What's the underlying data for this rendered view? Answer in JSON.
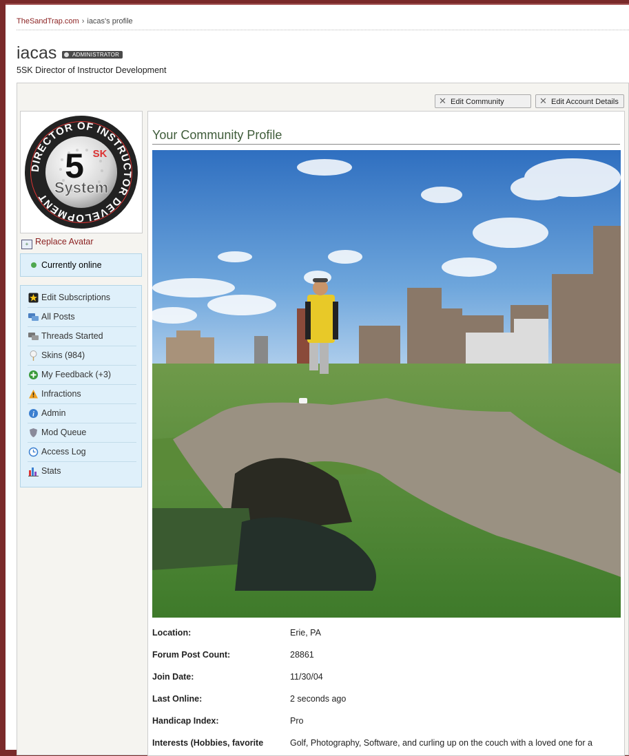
{
  "breadcrumb": {
    "home": "TheSandTrap.com",
    "separator": "›",
    "current": "iacas's profile"
  },
  "profile": {
    "username": "iacas",
    "badge": "ADMINISTRATOR",
    "user_title": "5SK Director of Instructor Development"
  },
  "toolbar": {
    "edit_community_profile": "Edit Community Profile",
    "edit_account_details": "Edit Account Details"
  },
  "avatar": {
    "ring_text": "DIRECTOR OF INSTRUCTOR DEVELOPMENT",
    "logo_number": "5",
    "logo_superscript": "SK",
    "logo_word": "System"
  },
  "sidebar": {
    "replace_avatar": "Replace Avatar",
    "online_status": "Currently online",
    "items": [
      {
        "label": "Edit Subscriptions",
        "icon": "star-icon"
      },
      {
        "label": "All Posts",
        "icon": "posts-icon"
      },
      {
        "label": "Threads Started",
        "icon": "threads-icon"
      },
      {
        "label": "Skins (984)",
        "icon": "golf-tee-icon"
      },
      {
        "label": "My Feedback (+3)",
        "icon": "plus-circle-icon"
      },
      {
        "label": "Infractions",
        "icon": "warning-icon"
      },
      {
        "label": "Admin",
        "icon": "info-icon"
      },
      {
        "label": "Mod Queue",
        "icon": "shield-icon"
      },
      {
        "label": "Access Log",
        "icon": "clock-icon"
      },
      {
        "label": "Stats",
        "icon": "bar-chart-icon"
      }
    ]
  },
  "main": {
    "title": "Your Community Profile",
    "info": [
      {
        "label": "Location:",
        "value": "Erie, PA"
      },
      {
        "label": "Forum Post Count:",
        "value": "28861"
      },
      {
        "label": "Join Date:",
        "value": "11/30/04"
      },
      {
        "label": "Last Online:",
        "value": "2 seconds ago"
      },
      {
        "label": "Handicap Index:",
        "value": "Pro"
      },
      {
        "label": "Interests (Hobbies, favorite",
        "value": "Golf, Photography, Software, and curling up on the couch with a loved one for a"
      }
    ]
  },
  "colors": {
    "link": "#8a1f1f",
    "sidebar_bg": "#dff0fa",
    "online_dot": "#4fa84f",
    "title_green": "#3f5c3a"
  }
}
